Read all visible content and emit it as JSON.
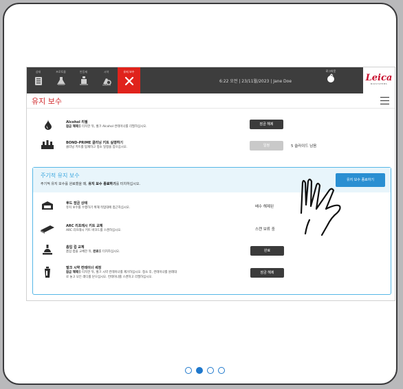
{
  "topbar": {
    "nav": [
      {
        "label": "상태",
        "icon": "slide-rack-icon"
      },
      {
        "label": "프로토콜",
        "icon": "protocol-flask-icon"
      },
      {
        "label": "반응제",
        "icon": "reagent-bottle-icon"
      },
      {
        "label": "시약",
        "icon": "microscope-icon"
      },
      {
        "label": "유지 보수",
        "icon": "maintenance-tools-icon",
        "active": true
      }
    ],
    "status": "6:22 오전  |  23/11월/2023  |  Jane Doe",
    "logout_label": "로그아웃",
    "brand_name": "Leica",
    "brand_sub": "BIOSYSTEMS"
  },
  "page_title": "유지 보수",
  "items": [
    {
      "title": "Alcohol 리필",
      "desc_bold": "잠금 해제",
      "desc_rest": "를 터치한 뒤, 벌크 Alcohol 컨테이너를 리필하십시오.",
      "button": "잠금 해제"
    },
    {
      "title": "BOND-PRIME 클리닝 키트 실행하기",
      "desc": "클리닝 키트를 탑재하고 청소 일정을 잡으십시오.",
      "button": "일정",
      "status": "5 슬라이드 남음"
    }
  ],
  "periodic": {
    "title": "주기적 유지 보수",
    "subtitle_pre": "주기적 유지 보수를 완료했을 때, ",
    "subtitle_bold": "유지 보수 종료하기",
    "subtitle_post": "를 터치하십시오.",
    "end_button": "유지 보수 종료하기",
    "items": [
      {
        "title": "후드 잠금 상태",
        "desc": "유지 보수를 수행하기 위해 작업대에 접근하십시오.",
        "status": "배수 해제된"
      },
      {
        "title": "ARC 리프레시 키트 교체",
        "desc": "ARC 리프레시 키트 바코드를 스캔하십시오.",
        "status": "스캔 보류 중"
      },
      {
        "title": "흡입 컵 교체",
        "desc_pre": "흡입 컵을 교체한 뒤, ",
        "desc_bold": "완료",
        "desc_post": "를 터치하십시오.",
        "button": "완료"
      },
      {
        "title": "벌크 시약 컨테이너 세정",
        "desc_bold": "잠금 해제",
        "desc_rest": "를 터치한 뒤, 벌크 시약 컨테이너를 제거하십시오. 청소 후, 컨테이너를 원래대",
        "desc_line2": "로 놓고 모든 래디를 닫으십시오. 컨테이너를 스캔하고 리필하십시오.",
        "button": "잠금 해제"
      }
    ]
  },
  "pager": {
    "count": 4,
    "active": 1
  },
  "colors": {
    "accent_red": "#d0272a",
    "accent_blue": "#2a8fd2",
    "topbar": "#3d3d3d"
  }
}
